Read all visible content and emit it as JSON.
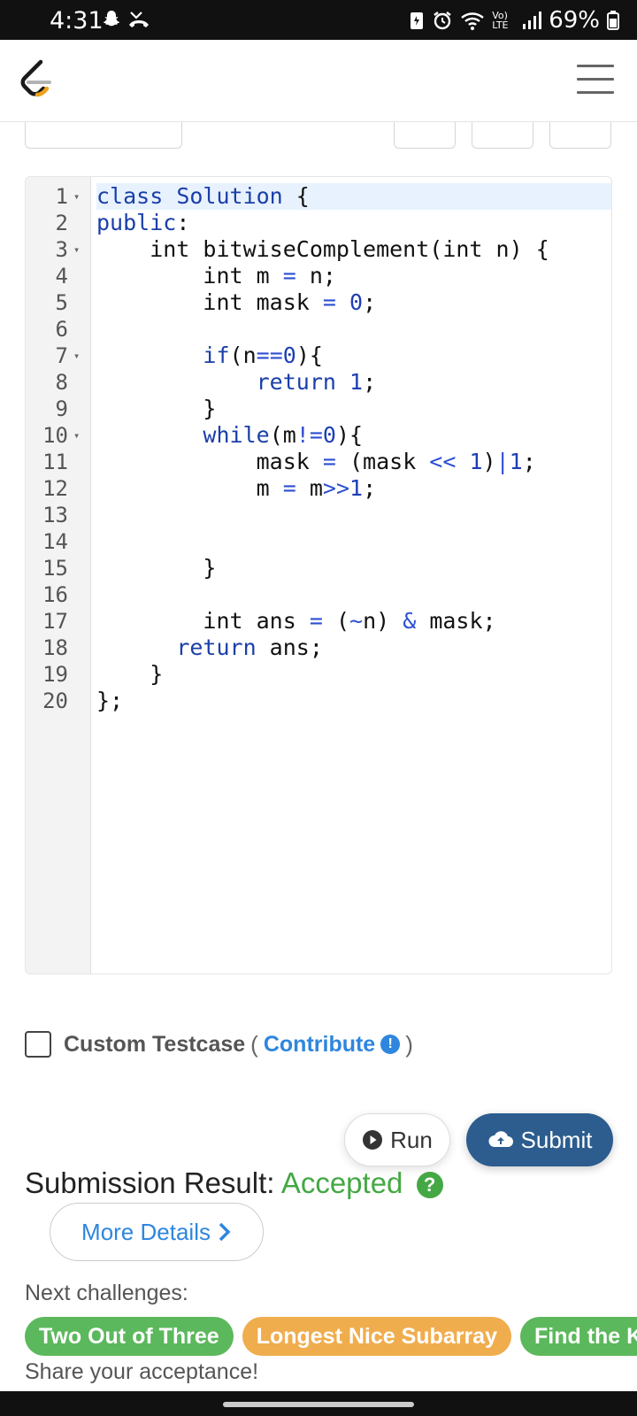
{
  "status_bar": {
    "time": "4:31",
    "battery": "69%",
    "network": "Vo) LTE"
  },
  "header": {
    "logo_icon": "leetcode-logo-icon",
    "menu_icon": "hamburger-menu-icon"
  },
  "editor": {
    "lines": [
      {
        "n": "1",
        "fold": true,
        "text": "class Solution {"
      },
      {
        "n": "2",
        "fold": false,
        "text": "public:"
      },
      {
        "n": "3",
        "fold": true,
        "text": "    int bitwiseComplement(int n) {"
      },
      {
        "n": "4",
        "fold": false,
        "text": "        int m = n;"
      },
      {
        "n": "5",
        "fold": false,
        "text": "        int mask = 0;"
      },
      {
        "n": "6",
        "fold": false,
        "text": ""
      },
      {
        "n": "7",
        "fold": true,
        "text": "        if(n==0){"
      },
      {
        "n": "8",
        "fold": false,
        "text": "            return 1;"
      },
      {
        "n": "9",
        "fold": false,
        "text": "        }"
      },
      {
        "n": "10",
        "fold": true,
        "text": "        while(m!=0){"
      },
      {
        "n": "11",
        "fold": false,
        "text": "            mask = (mask << 1)|1;"
      },
      {
        "n": "12",
        "fold": false,
        "text": "            m = m>>1;"
      },
      {
        "n": "13",
        "fold": false,
        "text": ""
      },
      {
        "n": "14",
        "fold": false,
        "text": ""
      },
      {
        "n": "15",
        "fold": false,
        "text": "        }"
      },
      {
        "n": "16",
        "fold": false,
        "text": ""
      },
      {
        "n": "17",
        "fold": false,
        "text": "        int ans = (~n) & mask;"
      },
      {
        "n": "18",
        "fold": false,
        "text": "      return ans;"
      },
      {
        "n": "19",
        "fold": false,
        "text": "    }"
      },
      {
        "n": "20",
        "fold": false,
        "text": "};"
      }
    ]
  },
  "custom_testcase": {
    "label": "Custom Testcase",
    "open_paren": "(",
    "contribute": "Contribute",
    "close_paren": ")"
  },
  "actions": {
    "run": "Run",
    "submit": "Submit"
  },
  "result": {
    "label": "Submission Result:",
    "status": "Accepted",
    "more_details": "More Details"
  },
  "next": {
    "label": "Next challenges:",
    "challenges": [
      {
        "name": "Two Out of Three",
        "color": "#5cb85c"
      },
      {
        "name": "Longest Nice Subarray",
        "color": "#f0ad4e"
      },
      {
        "name": "Find the K-",
        "color": "#5cb85c"
      }
    ],
    "share": "Share your acceptance!"
  }
}
